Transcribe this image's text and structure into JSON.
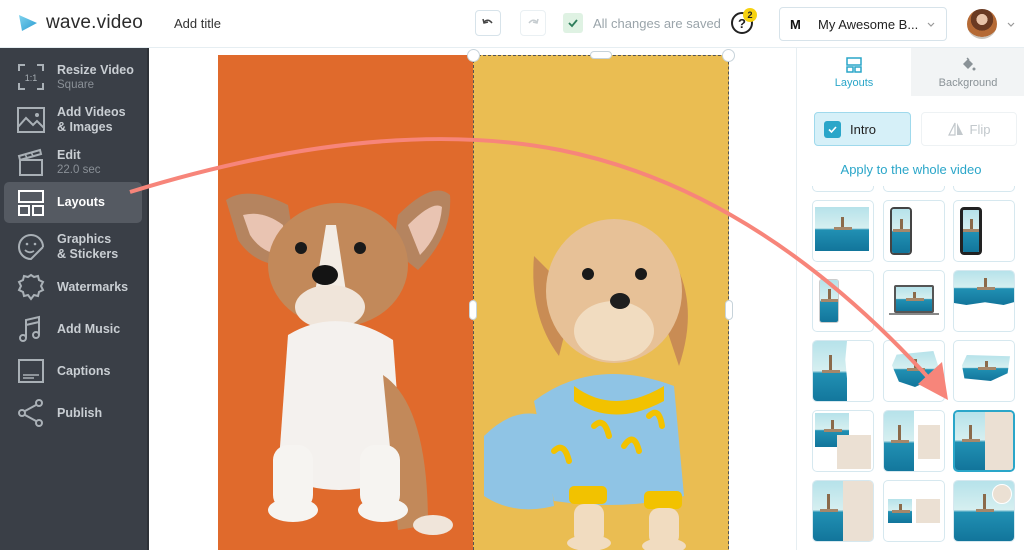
{
  "header": {
    "brand": "wave.video",
    "title_placeholder": "Add title",
    "saved_status": "All changes are saved",
    "help_badge_count": "2",
    "brand_initial": "M",
    "brand_name": "My Awesome B...",
    "icons": {
      "undo": "undo-icon",
      "redo": "redo-icon",
      "help": "help-icon",
      "chevron": "chevron-down-icon"
    }
  },
  "sidebar": {
    "items": [
      {
        "label": "Resize Video",
        "sub": "Square",
        "icon": "resize-icon",
        "icon_text": "1:1"
      },
      {
        "label": "Add Videos",
        "label2": "& Images",
        "icon": "image-icon"
      },
      {
        "label": "Edit",
        "sub": "22.0 sec",
        "icon": "clapperboard-icon"
      },
      {
        "label": "Layouts",
        "icon": "layouts-icon",
        "active": true
      },
      {
        "label": "Graphics",
        "label2": "& Stickers",
        "icon": "sticker-icon"
      },
      {
        "label": "Watermarks",
        "icon": "watermark-icon"
      },
      {
        "label": "Add Music",
        "icon": "music-icon"
      },
      {
        "label": "Captions",
        "icon": "captions-icon"
      },
      {
        "label": "Publish",
        "icon": "share-icon"
      }
    ]
  },
  "right_panel": {
    "tabs": [
      {
        "label": "Layouts",
        "active": true
      },
      {
        "label": "Background",
        "active": false
      }
    ],
    "intro_label": "Intro",
    "intro_checked": true,
    "flip_label": "Flip",
    "apply_link": "Apply to the whole video",
    "layouts": [
      "full-frame",
      "phone-notch",
      "phone-classic",
      "phone-left",
      "laptop",
      "brush-top",
      "half-left-image",
      "brush-center",
      "brush-right",
      "overlap-squares",
      "image-left-card-right",
      "split-selected",
      "split-image-sand",
      "two-small-squares",
      "full-with-circle"
    ],
    "selected_layout_index": 11
  },
  "canvas": {
    "left_panel_color": "#e06a2c",
    "right_panel_color": "#eabd52",
    "left_content": "corgi puppy on orange background",
    "right_content": "small dog in banana pajamas on yellow background"
  },
  "colors": {
    "accent": "#2aa6c9",
    "sidebar_bg": "#3a3f47",
    "annotation_arrow": "#f7857a"
  }
}
